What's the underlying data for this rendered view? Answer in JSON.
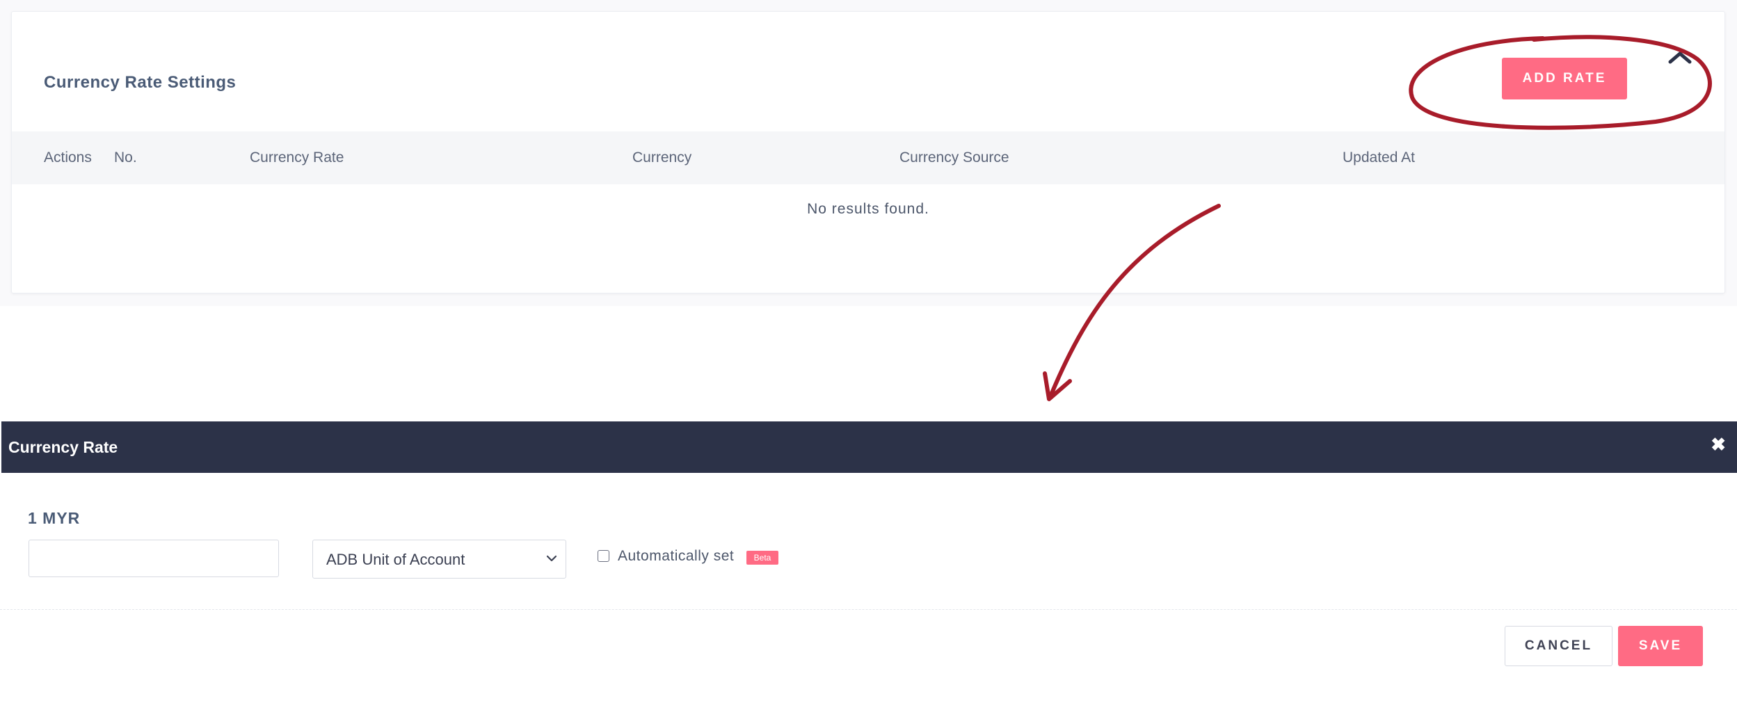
{
  "settings": {
    "title": "Currency Rate Settings",
    "add_rate_label": "ADD RATE",
    "collapse_icon": "chevron-up-icon",
    "columns": [
      "Actions",
      "No.",
      "Currency Rate",
      "Currency",
      "Currency Source",
      "Updated At"
    ],
    "empty_message": "No results found.",
    "accent_color": "#ff6b84"
  },
  "annotation": {
    "color": "#a81c2a",
    "shapes": [
      "circle-around-add-rate",
      "arrow-to-modal"
    ]
  },
  "modal": {
    "title": "Currency Rate",
    "close_icon": "close-icon",
    "header_color": "#2c3248",
    "base_label": "1 MYR",
    "rate_value": "",
    "currency_selected": "ADB Unit of Account",
    "auto_set_label": "Automatically set",
    "auto_set_checked": false,
    "beta_label": "Beta",
    "cancel_label": "CANCEL",
    "save_label": "SAVE"
  }
}
